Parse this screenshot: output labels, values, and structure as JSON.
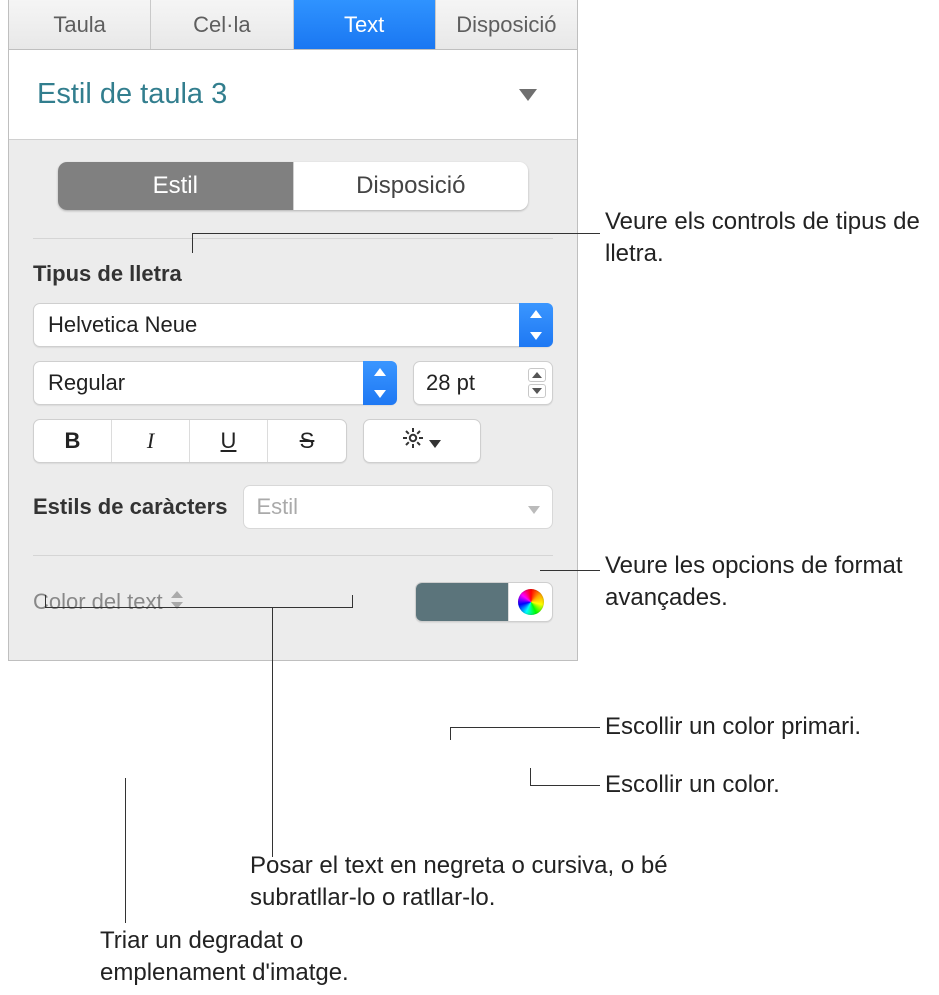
{
  "tabs": {
    "taula": "Taula",
    "cella": "Cel·la",
    "text": "Text",
    "disposicio": "Disposició"
  },
  "style_picker": {
    "current": "Estil de taula 3"
  },
  "segmented": {
    "estil": "Estil",
    "disposicio": "Disposició"
  },
  "font_section": {
    "label": "Tipus de lletra",
    "family": "Helvetica Neue",
    "weight": "Regular",
    "size": "28 pt",
    "buttons": {
      "bold": "B",
      "italic": "I",
      "underline": "U",
      "strike": "S"
    }
  },
  "char_styles": {
    "label": "Estils de caràcters",
    "placeholder": "Estil"
  },
  "text_color": {
    "label": "Color del text",
    "swatch": "#5b747b"
  },
  "callouts": {
    "font_controls": "Veure els controls de tipus de lletra.",
    "advanced": "Veure les opcions de format avançades.",
    "primary_color": "Escollir un color primari.",
    "any_color": "Escollir un color.",
    "bius": "Posar el text en negreta o cursiva, o bé subratllar-lo o ratllar-lo.",
    "gradient": "Triar un degradat o emplenament d'imatge."
  }
}
